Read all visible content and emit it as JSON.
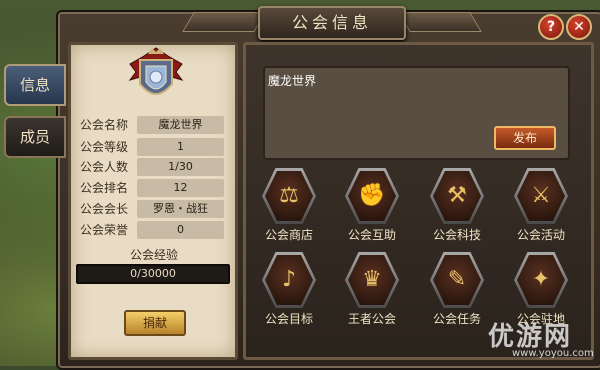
{
  "title": "公会信息",
  "top_buttons": {
    "help": "?",
    "close": "✕"
  },
  "tabs": [
    {
      "label": "信息",
      "active": true
    },
    {
      "label": "成员",
      "active": false
    }
  ],
  "guild": {
    "rows": [
      {
        "label": "公会名称",
        "value": "魔龙世界"
      },
      {
        "label": "公会等级",
        "value": "1"
      },
      {
        "label": "公会人数",
        "value": "1/30"
      },
      {
        "label": "公会排名",
        "value": "12"
      },
      {
        "label": "公会会长",
        "value": "罗恩・战狂"
      },
      {
        "label": "公会荣誉",
        "value": "0"
      }
    ],
    "exp_label": "公会经验",
    "exp_text": "0/30000",
    "exp_progress": 0,
    "donate_label": "捐献"
  },
  "notice": {
    "text": "魔龙世界",
    "publish_label": "发布"
  },
  "features": [
    {
      "label": "公会商店",
      "icon": "shop-icon"
    },
    {
      "label": "公会互助",
      "icon": "handshake-icon"
    },
    {
      "label": "公会科技",
      "icon": "tech-icon"
    },
    {
      "label": "公会活动",
      "icon": "activity-icon"
    },
    {
      "label": "公会目标",
      "icon": "horn-icon"
    },
    {
      "label": "王者公会",
      "icon": "crown-icon"
    },
    {
      "label": "公会任务",
      "icon": "scroll-icon"
    },
    {
      "label": "公会驻地",
      "icon": "map-icon"
    }
  ],
  "watermark": {
    "big": "优游网",
    "small": "www.yoyou.com"
  }
}
